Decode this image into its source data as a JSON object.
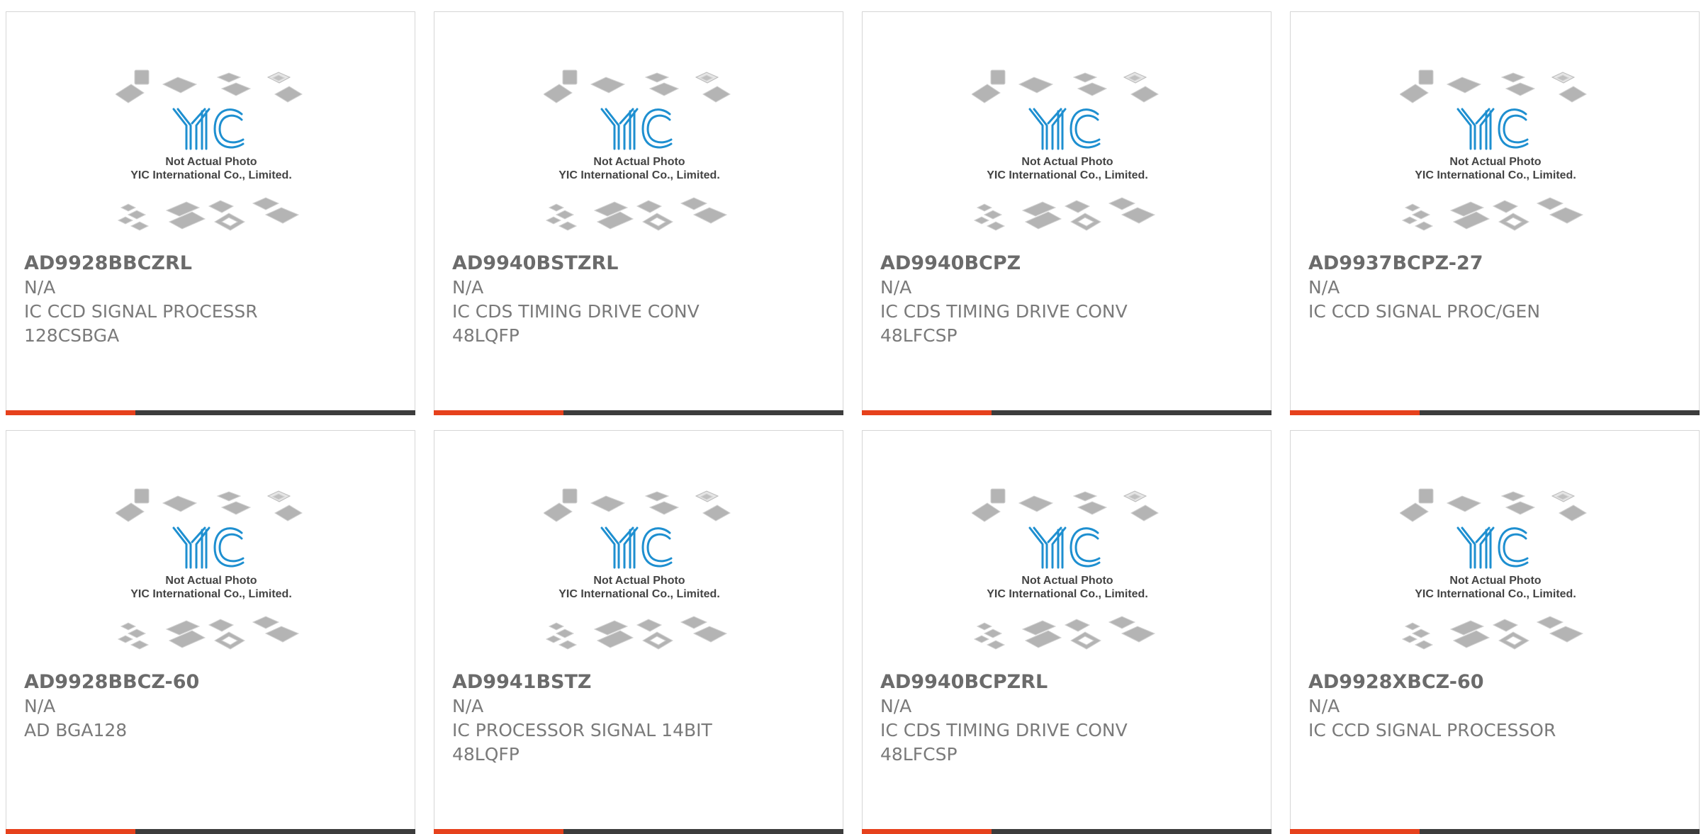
{
  "placeholder": {
    "logo_text": "YIC",
    "line1": "Not Actual Photo",
    "line2": "YIC International Co., Limited."
  },
  "colors": {
    "accent": "#e6411c",
    "bar": "#3c3c3c",
    "logo": "#1e8fd0",
    "text": "#7a7a7a"
  },
  "products": [
    {
      "part": "AD9928BBCZRL",
      "mfr": "N/A",
      "desc1": "IC CCD SIGNAL PROCESSR",
      "desc2": "128CSBGA"
    },
    {
      "part": "AD9940BSTZRL",
      "mfr": "N/A",
      "desc1": "IC CDS TIMING DRIVE CONV",
      "desc2": "48LQFP"
    },
    {
      "part": "AD9940BCPZ",
      "mfr": "N/A",
      "desc1": "IC CDS TIMING DRIVE CONV",
      "desc2": "48LFCSP"
    },
    {
      "part": "AD9937BCPZ-27",
      "mfr": "N/A",
      "desc1": "IC CCD SIGNAL PROC/GEN",
      "desc2": ""
    },
    {
      "part": "AD9928BBCZ-60",
      "mfr": "N/A",
      "desc1": "AD BGA128",
      "desc2": ""
    },
    {
      "part": "AD9941BSTZ",
      "mfr": "N/A",
      "desc1": "IC PROCESSOR SIGNAL 14BIT",
      "desc2": "48LQFP"
    },
    {
      "part": "AD9940BCPZRL",
      "mfr": "N/A",
      "desc1": "IC CDS TIMING DRIVE CONV",
      "desc2": "48LFCSP"
    },
    {
      "part": "AD9928XBCZ-60",
      "mfr": "N/A",
      "desc1": "IC CCD SIGNAL PROCESSOR",
      "desc2": ""
    }
  ]
}
